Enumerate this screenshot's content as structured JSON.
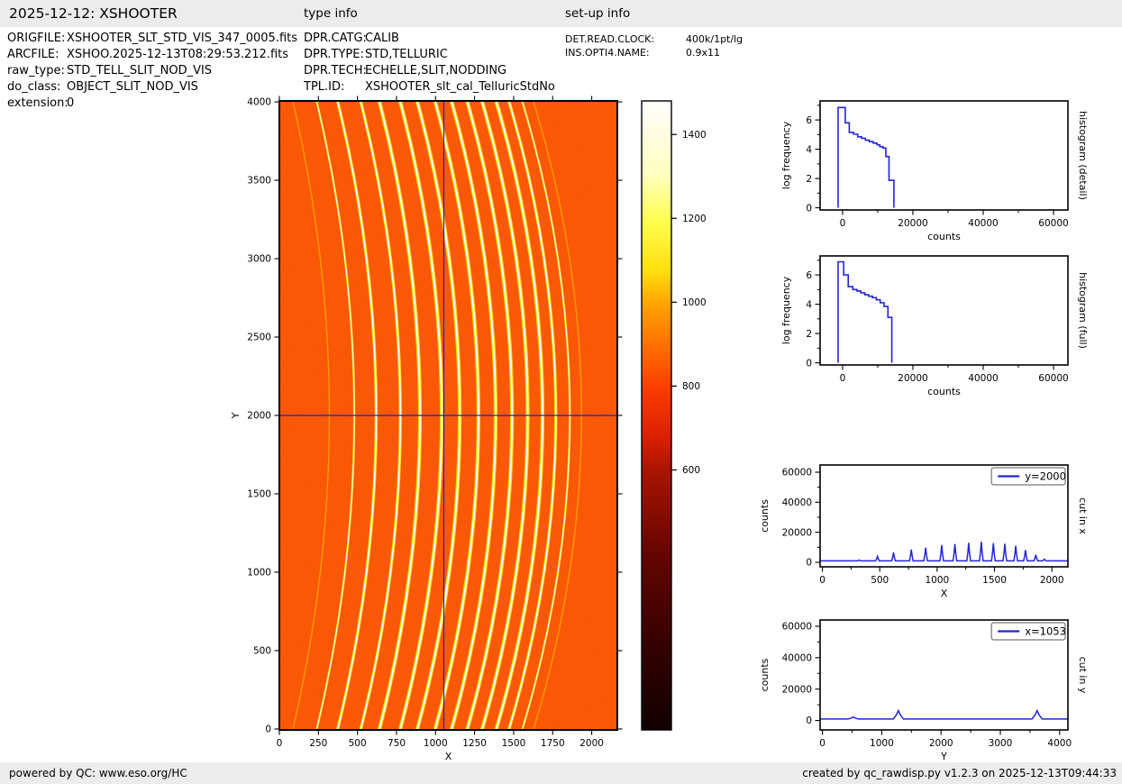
{
  "header": {
    "title": "2025-12-12: XSHOOTER",
    "type_info_title": "type info",
    "setup_info_title": "set-up info"
  },
  "file_info": {
    "rows": [
      {
        "label": "ORIGFILE:",
        "value": "XSHOOTER_SLT_STD_VIS_347_0005.fits"
      },
      {
        "label": "ARCFILE:",
        "value": "XSHOO.2025-12-13T08:29:53.212.fits"
      },
      {
        "label": "raw_type:",
        "value": "STD_TELL_SLIT_NOD_VIS"
      },
      {
        "label": "do_class:",
        "value": "OBJECT_SLIT_NOD_VIS"
      },
      {
        "label": "extension:",
        "value": "0"
      }
    ]
  },
  "type_info": {
    "rows": [
      {
        "label": "DPR.CATG:",
        "value": "CALIB"
      },
      {
        "label": "DPR.TYPE:",
        "value": "STD,TELLURIC"
      },
      {
        "label": "DPR.TECH:",
        "value": "ECHELLE,SLIT,NODDING"
      },
      {
        "label": "TPL.ID:",
        "value": "XSHOOTER_slt_cal_TelluricStdNo"
      }
    ]
  },
  "setup_info": {
    "rows": [
      {
        "label": "DET.READ.CLOCK:",
        "value": "400k/1pt/lg"
      },
      {
        "label": "INS.OPTI4.NAME:",
        "value": "0.9x11"
      }
    ]
  },
  "footer": {
    "left": "powered by QC: www.eso.org/HC",
    "right": "created by qc_rawdisp.py v1.2.3 on 2025-12-13T09:44:33"
  },
  "colors": {
    "line_blue": "#2424d9",
    "crosshair_blue": "#1d1dc8",
    "image_background": "#fa4e02",
    "trace_glow": "#ffdf00",
    "trace_core": "#ffffff",
    "panel_gray": "#ececec"
  },
  "chart_data": {
    "main_image": {
      "type": "heatmap",
      "xlabel": "X",
      "ylabel": "Y",
      "xlim": [
        0,
        2164
      ],
      "ylim": [
        -6,
        4006
      ],
      "xticks": [
        0,
        250,
        500,
        750,
        1000,
        1250,
        1500,
        1750,
        2000
      ],
      "yticks": [
        0,
        500,
        1000,
        1500,
        2000,
        2500,
        3000,
        3500,
        4000
      ],
      "background_counts": 950,
      "crosshair": {
        "x": 1053,
        "y": 2000
      },
      "orders": [
        [
          320,
          1500
        ],
        [
          480,
          4000
        ],
        [
          620,
          6500
        ],
        [
          775,
          8500
        ],
        [
          900,
          9800
        ],
        [
          1040,
          11500
        ],
        [
          1155,
          12200
        ],
        [
          1275,
          13000
        ],
        [
          1385,
          13700
        ],
        [
          1490,
          12800
        ],
        [
          1590,
          12400
        ],
        [
          1685,
          11000
        ],
        [
          1770,
          8200
        ],
        [
          1860,
          5000
        ],
        [
          1935,
          2100
        ]
      ],
      "ylabel_off": -45,
      "lw": 2
    },
    "colorbar": {
      "type": "colorbar",
      "vmin": -20,
      "vmax": 1480,
      "ticks": [
        600,
        800,
        1000,
        1200,
        1400
      ],
      "gradient": [
        [
          0,
          "#ffffff"
        ],
        [
          0.05,
          "#fffce3"
        ],
        [
          0.12,
          "#ffffbe"
        ],
        [
          0.19,
          "#ffff50"
        ],
        [
          0.27,
          "#ffdf0d"
        ],
        [
          0.33,
          "#ff9d00"
        ],
        [
          0.39,
          "#ff6f00"
        ],
        [
          0.46,
          "#fb3b00"
        ],
        [
          0.53,
          "#dd2100"
        ],
        [
          0.59,
          "#a81300"
        ],
        [
          0.72,
          "#650500"
        ],
        [
          0.87,
          "#330100"
        ],
        [
          1,
          "#120000"
        ]
      ]
    },
    "histogram_detail": {
      "type": "steps",
      "xlabel": "counts",
      "ylabel": "log frequency",
      "side_label": "histogram (detail)",
      "xlim": [
        -6400,
        64100
      ],
      "ylim": [
        -0.15,
        7.3
      ],
      "xticks": [
        0,
        20000,
        40000,
        60000
      ],
      "xminor": [
        10000,
        30000,
        50000
      ],
      "yticks": [
        0,
        2,
        4,
        6
      ],
      "yminor": [
        1,
        3,
        5,
        7
      ],
      "steps": [
        [
          -1280,
          0
        ],
        [
          -1280,
          6.85
        ],
        [
          760,
          6.85
        ],
        [
          760,
          5.8
        ],
        [
          1900,
          5.8
        ],
        [
          1900,
          5.15
        ],
        [
          3100,
          5.15
        ],
        [
          3100,
          5.03
        ],
        [
          4300,
          5.03
        ],
        [
          4300,
          4.85
        ],
        [
          5400,
          4.85
        ],
        [
          5400,
          4.75
        ],
        [
          6500,
          4.75
        ],
        [
          6500,
          4.62
        ],
        [
          7600,
          4.62
        ],
        [
          7600,
          4.52
        ],
        [
          8700,
          4.52
        ],
        [
          8700,
          4.42
        ],
        [
          9800,
          4.42
        ],
        [
          9800,
          4.3
        ],
        [
          10600,
          4.3
        ],
        [
          10600,
          4.17
        ],
        [
          11500,
          4.17
        ],
        [
          11500,
          4.08
        ],
        [
          12300,
          4.08
        ],
        [
          12300,
          3.5
        ],
        [
          13200,
          3.5
        ],
        [
          13200,
          1.88
        ],
        [
          14600,
          1.88
        ],
        [
          14600,
          0
        ]
      ],
      "ylabel_off": -34,
      "lw": 1.6
    },
    "histogram_full": {
      "type": "steps",
      "xlabel": "counts",
      "ylabel": "log frequency",
      "side_label": "histogram (full)",
      "xlim": [
        -6400,
        64100
      ],
      "ylim": [
        -0.15,
        7.3
      ],
      "xticks": [
        0,
        20000,
        40000,
        60000
      ],
      "xminor": [
        10000,
        30000,
        50000
      ],
      "yticks": [
        0,
        2,
        4,
        6
      ],
      "yminor": [
        1,
        3,
        5,
        7
      ],
      "steps": [
        [
          -1280,
          0
        ],
        [
          -1280,
          6.9
        ],
        [
          300,
          6.9
        ],
        [
          300,
          6.0
        ],
        [
          1600,
          6.0
        ],
        [
          1600,
          5.2
        ],
        [
          2900,
          5.2
        ],
        [
          2900,
          5.0
        ],
        [
          4100,
          5.0
        ],
        [
          4100,
          4.9
        ],
        [
          5200,
          4.9
        ],
        [
          5200,
          4.78
        ],
        [
          6300,
          4.78
        ],
        [
          6300,
          4.65
        ],
        [
          7400,
          4.65
        ],
        [
          7400,
          4.55
        ],
        [
          8500,
          4.55
        ],
        [
          8500,
          4.45
        ],
        [
          9600,
          4.45
        ],
        [
          9600,
          4.3
        ],
        [
          10700,
          4.3
        ],
        [
          10700,
          4.1
        ],
        [
          11800,
          4.1
        ],
        [
          11800,
          3.85
        ],
        [
          12900,
          3.85
        ],
        [
          12900,
          3.1
        ],
        [
          14000,
          3.1
        ],
        [
          14000,
          0
        ]
      ],
      "ylabel_off": -34,
      "lw": 1.6
    },
    "cut_x": {
      "type": "peaks",
      "legend": "y=2000",
      "xlabel": "X",
      "ylabel": "counts",
      "side_label": "cut in x",
      "xlim": [
        -20,
        2140
      ],
      "ylim": [
        -3000,
        64800
      ],
      "xticks": [
        0,
        500,
        1000,
        1500,
        2000
      ],
      "xminor": [
        250,
        750,
        1250,
        1750
      ],
      "yticks": [
        0,
        20000,
        40000,
        60000
      ],
      "yminor": [
        10000,
        30000,
        50000
      ],
      "baseline": 950,
      "spike_w": 16,
      "peaks": [
        [
          320,
          1500
        ],
        [
          480,
          4000
        ],
        [
          620,
          6500
        ],
        [
          775,
          8500
        ],
        [
          900,
          9800
        ],
        [
          1040,
          11500
        ],
        [
          1155,
          12200
        ],
        [
          1275,
          13000
        ],
        [
          1385,
          13700
        ],
        [
          1490,
          12800
        ],
        [
          1590,
          12400
        ],
        [
          1685,
          11000
        ],
        [
          1770,
          8200
        ],
        [
          1860,
          5000
        ],
        [
          1935,
          2100
        ]
      ],
      "ylabel_off": -58,
      "lw": 1.5
    },
    "cut_y": {
      "type": "peaks",
      "legend": "x=1053",
      "xlabel": "Y",
      "ylabel": "counts",
      "side_label": "cut in y",
      "xlim": [
        -40,
        4140
      ],
      "ylim": [
        -6000,
        64000
      ],
      "xticks": [
        0,
        1000,
        2000,
        3000,
        4000
      ],
      "xminor": [
        500,
        1500,
        2500,
        3500
      ],
      "yticks": [
        0,
        20000,
        40000,
        60000
      ],
      "yminor": [
        10000,
        30000,
        50000
      ],
      "baseline": 950,
      "spike_w": 85,
      "peaks": [
        [
          520,
          2200
        ],
        [
          1280,
          6300
        ],
        [
          3620,
          6300
        ]
      ],
      "ylabel_off": -58,
      "lw": 1.5
    }
  }
}
